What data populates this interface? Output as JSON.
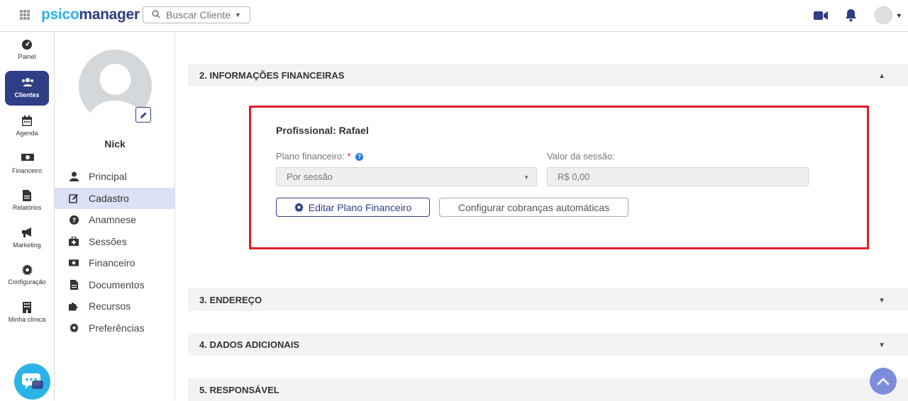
{
  "app": {
    "logo_part1": "psico",
    "logo_part2": "manager"
  },
  "topbar": {
    "search_label": "Buscar Cliente",
    "icons": [
      "apps-grid-icon",
      "search-icon",
      "video-camera-icon",
      "bell-icon",
      "user-avatar"
    ]
  },
  "rail": {
    "items": [
      {
        "label": "Painel",
        "icon": "dashboard-gauge-icon"
      },
      {
        "label": "Clientes",
        "icon": "users-icon",
        "active": true
      },
      {
        "label": "Agenda",
        "icon": "calendar-icon"
      },
      {
        "label": "Financeiro",
        "icon": "money-icon"
      },
      {
        "label": "Relatórios",
        "icon": "report-file-icon"
      },
      {
        "label": "Marketing",
        "icon": "megaphone-icon"
      },
      {
        "label": "Configuração",
        "icon": "gear-icon"
      },
      {
        "label": "Minha clínica",
        "icon": "building-icon"
      }
    ]
  },
  "profile": {
    "name": "Nick",
    "menu": [
      {
        "label": "Principal",
        "icon": "user-icon"
      },
      {
        "label": "Cadastro",
        "icon": "edit-icon",
        "active": true
      },
      {
        "label": "Anamnese",
        "icon": "question-circle-icon"
      },
      {
        "label": "Sessões",
        "icon": "briefcase-medical-icon"
      },
      {
        "label": "Financeiro",
        "icon": "money-icon"
      },
      {
        "label": "Documentos",
        "icon": "document-icon"
      },
      {
        "label": "Recursos",
        "icon": "puzzle-icon"
      },
      {
        "label": "Preferências",
        "icon": "gear-icon"
      }
    ]
  },
  "sections": {
    "financial": {
      "title": "2. INFORMAÇÕES FINANCEIRAS",
      "professional": "Profissional: Rafael",
      "plan_label": "Plano financeiro:",
      "plan_required": "*",
      "plan_help": "?",
      "plan_value": "Por sessão",
      "session_value_label": "Valor da sessão:",
      "session_value": "R$ 0,00",
      "edit_plan_button": "Editar Plano Financeiro",
      "auto_billing_button": "Configurar cobranças automáticas"
    },
    "address": {
      "title": "3. ENDEREÇO"
    },
    "additional": {
      "title": "4. DADOS ADICIONAIS"
    },
    "responsible": {
      "title": "5. RESPONSÁVEL"
    }
  },
  "colors": {
    "brand_dark": "#2f3e85",
    "brand_light": "#2bb3e8",
    "highlight": "#e01f26"
  }
}
